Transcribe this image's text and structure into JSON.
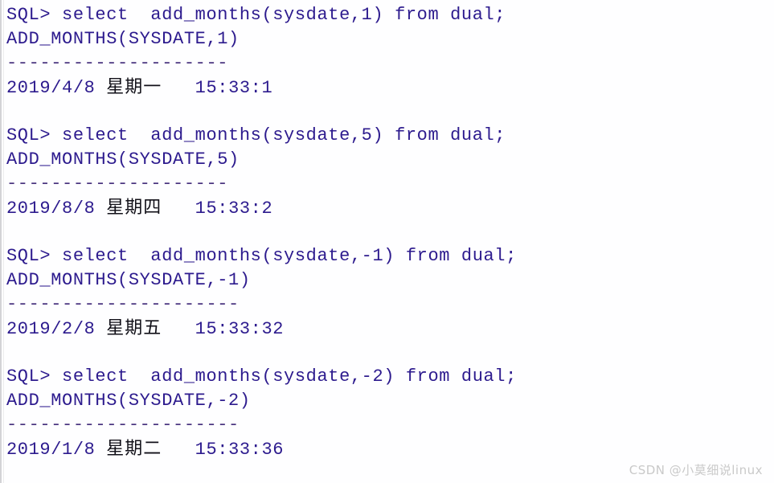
{
  "terminal": {
    "prompt_symbol": "SQL>",
    "text_color": "#2d1b8e",
    "rule_color": "#4a3580",
    "cjk_color": "#111018",
    "background": "#fefeff",
    "blocks": [
      {
        "command": "SQL> select  add_months(sysdate,1) from dual;",
        "column_header": "ADD_MONTHS(SYSDATE,1)",
        "rule": "--------------------",
        "value_date": "2019/4/8",
        "value_weekday": "星期一",
        "value_time": "15:33:1",
        "value_full": "2019/4/8 星期一   15:33:1"
      },
      {
        "command": "SQL> select  add_months(sysdate,5) from dual;",
        "column_header": "ADD_MONTHS(SYSDATE,5)",
        "rule": "--------------------",
        "value_date": "2019/8/8",
        "value_weekday": "星期四",
        "value_time": "15:33:2",
        "value_full": "2019/8/8 星期四   15:33:2"
      },
      {
        "command": "SQL> select  add_months(sysdate,-1) from dual;",
        "column_header": "ADD_MONTHS(SYSDATE,-1)",
        "rule": "---------------------",
        "value_date": "2019/2/8",
        "value_weekday": "星期五",
        "value_time": "15:33:32",
        "value_full": "2019/2/8 星期五   15:33:32"
      },
      {
        "command": "SQL> select  add_months(sysdate,-2) from dual;",
        "column_header": "ADD_MONTHS(SYSDATE,-2)",
        "rule": "---------------------",
        "value_date": "2019/1/8",
        "value_weekday": "星期二",
        "value_time": "15:33:36",
        "value_full": "2019/1/8 星期二   15:33:36"
      }
    ]
  },
  "watermark": {
    "text": "CSDN @小莫细说linux",
    "color": "#c9c9c9"
  }
}
